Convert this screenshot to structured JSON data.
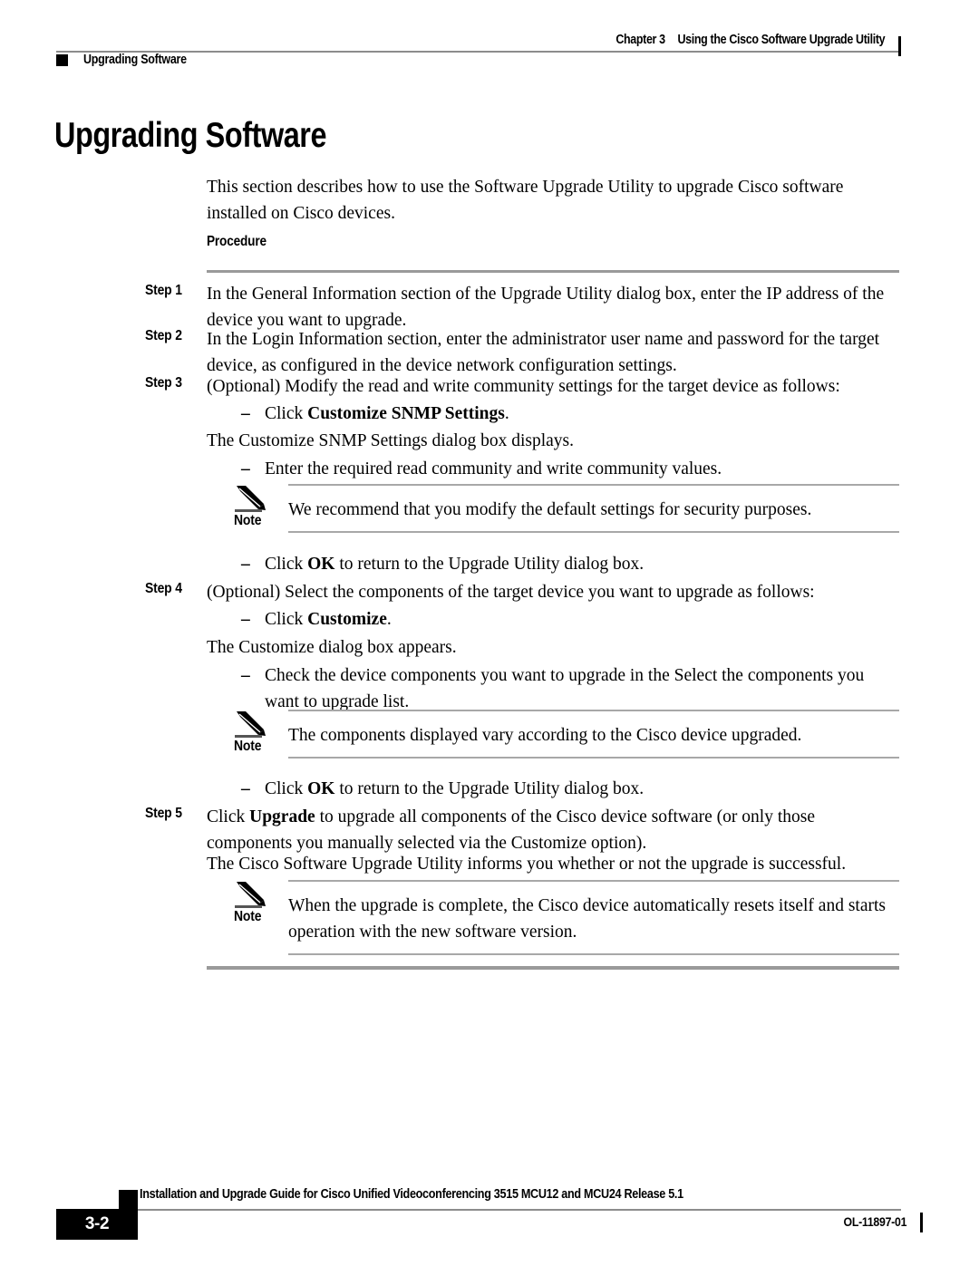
{
  "header": {
    "chapter": "Chapter 3",
    "chapter_title": "Using the Cisco Software Upgrade Utility",
    "section": "Upgrading Software"
  },
  "page_title": "Upgrading Software",
  "intro": "This section describes how to use the Software Upgrade Utility to upgrade Cisco software installed on Cisco devices.",
  "procedure_label": "Procedure",
  "steps": {
    "step1": {
      "label": "Step 1",
      "text": "In the General Information section of the Upgrade Utility dialog box, enter the IP address of the device you want to upgrade."
    },
    "step2": {
      "label": "Step 2",
      "text": "In the Login Information section, enter the administrator user name and password for the target device, as configured in the device network configuration settings."
    },
    "step3": {
      "label": "Step 3",
      "text": "(Optional) Modify the read and write community settings for the target device as follows:",
      "bullet1_prefix": "Click ",
      "bullet1_bold": "Customize SNMP Settings",
      "bullet1_suffix": ".",
      "para1": "The Customize SNMP Settings dialog box displays.",
      "bullet2": "Enter the required read community and write community values.",
      "note_label": "Note",
      "note_text": "We recommend that you modify the default settings for security purposes.",
      "bullet3_prefix": "Click ",
      "bullet3_bold": "OK",
      "bullet3_suffix": " to return to the Upgrade Utility dialog box."
    },
    "step4": {
      "label": "Step 4",
      "text": "(Optional) Select the components of the target device you want to upgrade as follows:",
      "bullet1_prefix": "Click ",
      "bullet1_bold": "Customize",
      "bullet1_suffix": ".",
      "para1": "The Customize dialog box appears.",
      "bullet2": "Check the device components you want to upgrade in the Select the components you want to upgrade list.",
      "note_label": "Note",
      "note_text": "The components displayed vary according to the Cisco device upgraded.",
      "bullet3_prefix": "Click ",
      "bullet3_bold": "OK",
      "bullet3_suffix": " to return to the Upgrade Utility dialog box."
    },
    "step5": {
      "label": "Step 5",
      "text_prefix": "Click ",
      "text_bold": "Upgrade",
      "text_suffix": " to upgrade all components of the Cisco device software (or only those components you manually selected via the Customize option).",
      "para1": "The Cisco Software Upgrade Utility informs you whether or not the upgrade is successful.",
      "note_label": "Note",
      "note_text": "When the upgrade is complete, the Cisco device automatically resets itself and starts operation with the new software version."
    }
  },
  "bullet_dash": "–",
  "footer": {
    "title": "Installation and Upgrade Guide for Cisco Unified Videoconferencing 3515 MCU12 and MCU24 Release 5.1",
    "page_number": "3-2",
    "doc_id": "OL-11897-01"
  },
  "colors": {
    "rule_gray": "#9a9a9a",
    "note_rule_gray": "#a8a8a8",
    "black": "#000000"
  }
}
